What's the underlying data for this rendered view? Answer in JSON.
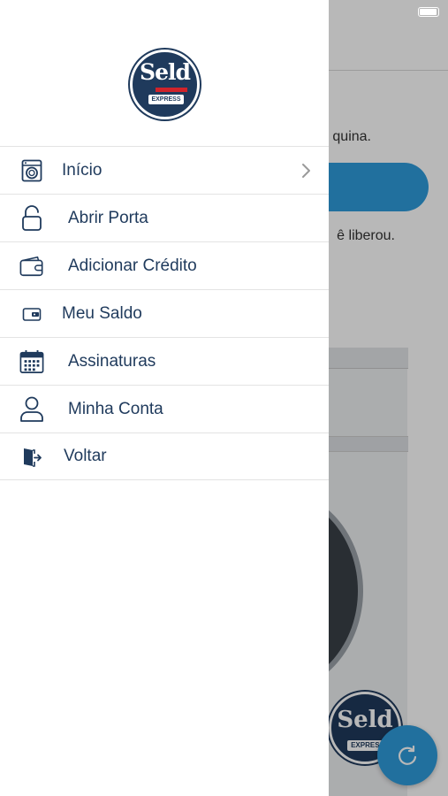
{
  "background": {
    "text_line1": "quina.",
    "text_line2": "ê liberou.",
    "logo_text": "Seld",
    "logo_sub": "EXPRESS"
  },
  "drawer": {
    "logo": {
      "main": "Seld",
      "sub": "EXPRESS"
    },
    "items": [
      {
        "label": "Início",
        "icon": "washing-machine-icon",
        "has_chevron": true
      },
      {
        "label": "Abrir Porta",
        "icon": "unlock-icon"
      },
      {
        "label": "Adicionar Crédito",
        "icon": "wallet-icon"
      },
      {
        "label": "Meu Saldo",
        "icon": "small-wallet-icon"
      },
      {
        "label": "Assinaturas",
        "icon": "calendar-icon"
      },
      {
        "label": "Minha Conta",
        "icon": "user-icon"
      },
      {
        "label": "Voltar",
        "icon": "exit-door-icon"
      }
    ]
  },
  "colors": {
    "primary": "#1f3a5c",
    "accent": "#2e9bdb"
  }
}
